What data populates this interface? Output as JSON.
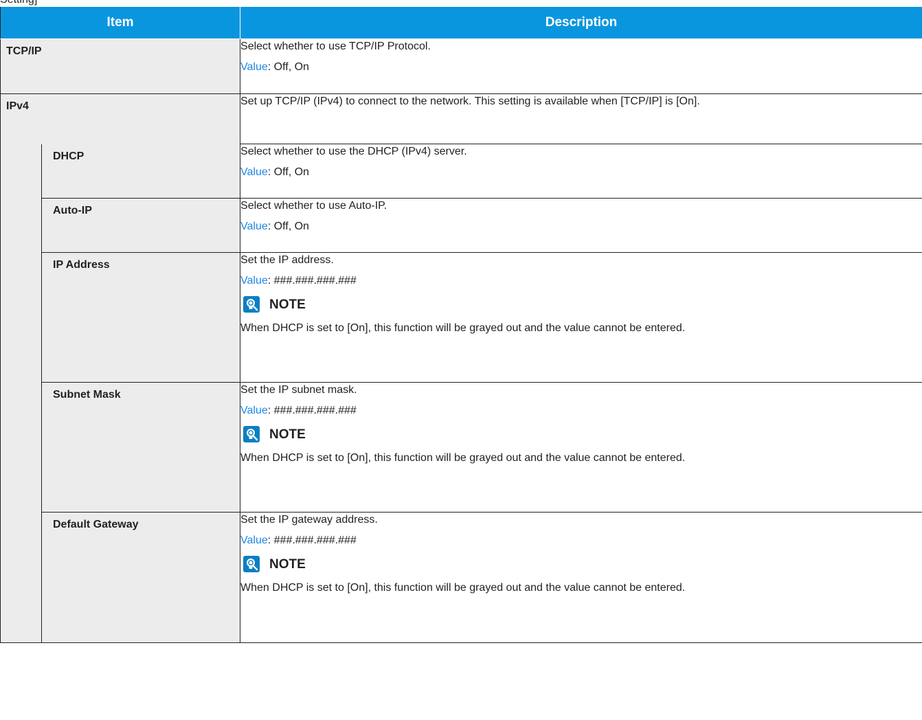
{
  "page_fragment": "Setting]",
  "table": {
    "header_item": "Item",
    "header_description": "Description"
  },
  "rows": {
    "tcpip": {
      "item": "TCP/IP",
      "desc": "Select whether to use TCP/IP Protocol.",
      "value_label": "Value",
      "value": ": Off, On"
    },
    "ipv4": {
      "item": "IPv4",
      "desc": "Set up TCP/IP (IPv4) to connect to the network. This setting is available when [TCP/IP] is [On]."
    },
    "dhcp": {
      "item": "DHCP",
      "desc": "Select whether to use the DHCP (IPv4) server.",
      "value_label": "Value",
      "value": ": Off, On"
    },
    "autoip": {
      "item": "Auto-IP",
      "desc": "Select whether to use Auto-IP.",
      "value_label": "Value",
      "value": ": Off, On"
    },
    "ipaddress": {
      "item": "IP Address",
      "desc": "Set the IP address.",
      "value_label": "Value",
      "value": ": ###.###.###.###",
      "note_title": "NOTE",
      "note_text": "When DHCP is set to [On], this function will be grayed out and the value cannot be entered."
    },
    "subnet": {
      "item": "Subnet Mask",
      "desc": "Set the IP subnet mask.",
      "value_label": "Value",
      "value": ": ###.###.###.###",
      "note_title": "NOTE",
      "note_text": "When DHCP is set to [On], this function will be grayed out and the value cannot be entered."
    },
    "gateway": {
      "item": "Default Gateway",
      "desc": "Set the IP gateway address.",
      "value_label": "Value",
      "value": ": ###.###.###.###",
      "note_title": "NOTE",
      "note_text": "When DHCP is set to [On], this function will be grayed out and the value cannot be entered."
    }
  },
  "colors": {
    "header_bg": "#0a96de",
    "item_bg": "#ececec",
    "value_label": "#1e88e5"
  },
  "icons": {
    "note": "lightbulb-note-icon"
  }
}
